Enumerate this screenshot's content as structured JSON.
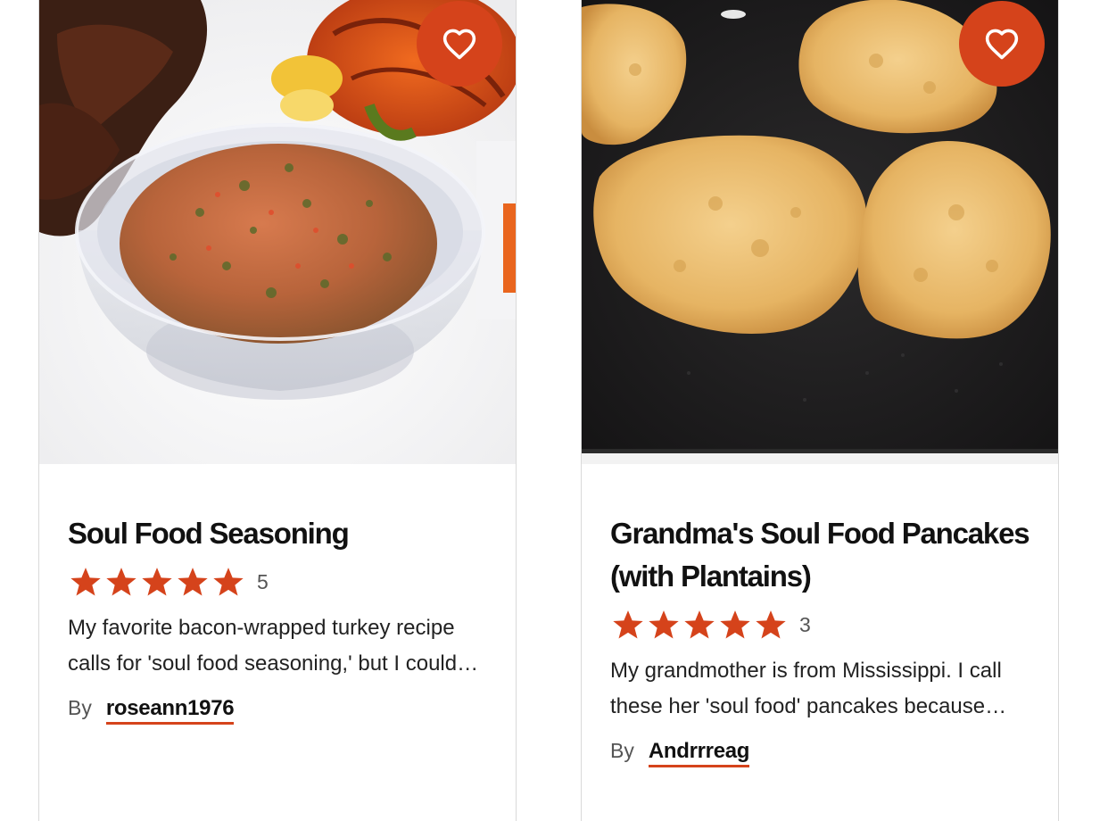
{
  "colors": {
    "accent": "#d5431b",
    "star": "#d5431b",
    "title": "#111111",
    "text": "#222222",
    "muted": "#555555",
    "border": "#d9d9d9"
  },
  "cards": [
    {
      "image_icon": "seasoning-bowl-photo",
      "favorite_icon": "heart-outline-icon",
      "title": "Soul Food Seasoning",
      "rating": 5,
      "rating_count": "5",
      "description": "My favorite bacon-wrapped turkey recipe calls for 'soul food seasoning,' but I could never find it in the store, so I made my own.",
      "by_label": "By",
      "author": "roseann1976"
    },
    {
      "image_icon": "pancakes-on-griddle-photo",
      "favorite_icon": "heart-outline-icon",
      "title": "Grandma's Soul Food Pancakes (with Plantains)",
      "rating": 5,
      "rating_count": "3",
      "description": "My grandmother is from Mississippi. I call these her 'soul food' pancakes because they are so comforting.",
      "by_label": "By",
      "author": "Andrrreag"
    }
  ]
}
